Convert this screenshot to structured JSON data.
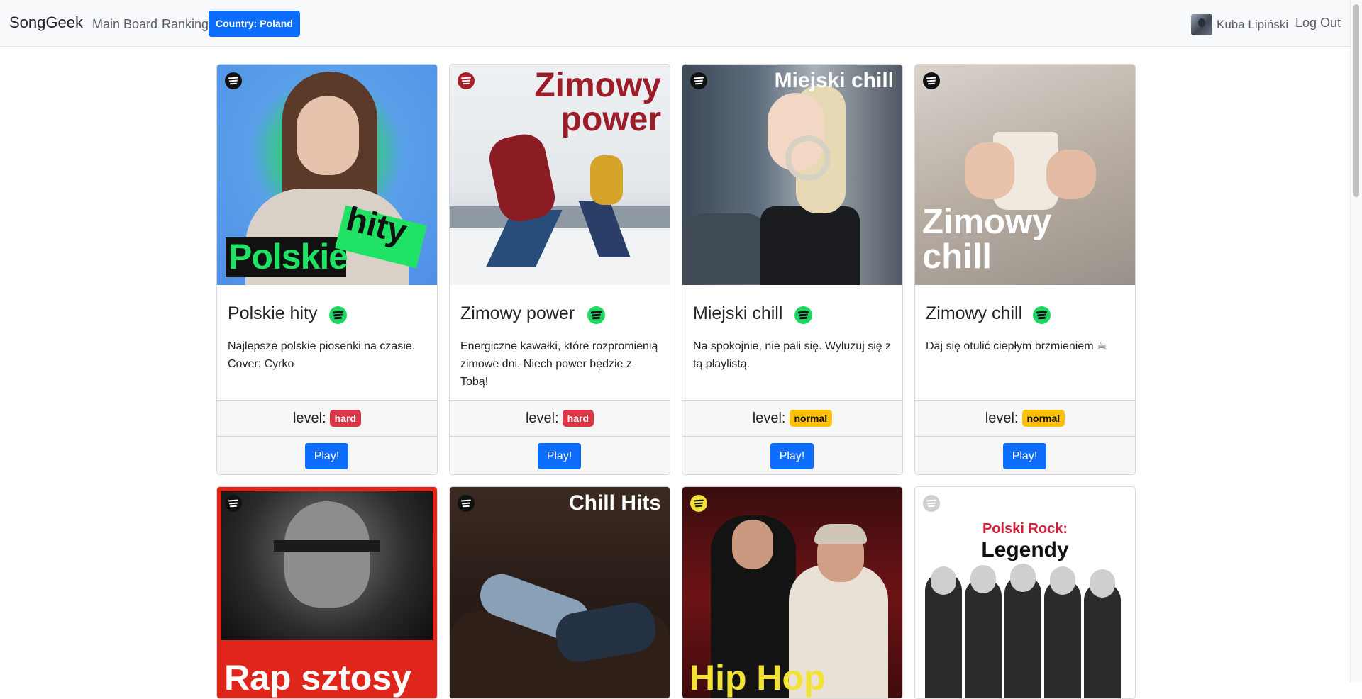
{
  "navbar": {
    "brand": "SongGeek",
    "links": [
      "Main Board",
      "Ranking"
    ],
    "country_button": "Country: Poland",
    "user_name": "Kuba Lipiński",
    "logout": "Log Out"
  },
  "level_label": "level:",
  "play_label": "Play!",
  "colors": {
    "primary": "#0d6efd",
    "hard": "#dc3545",
    "normal": "#ffc107",
    "spotify_green": "#1ed760"
  },
  "playlists": [
    {
      "cover_lines": [
        "Polskie",
        "hity"
      ],
      "title": "Polskie hity",
      "description": "Najlepsze polskie piosenki na czasie. Cover: Cyrko",
      "level": "hard"
    },
    {
      "cover_lines": [
        "Zimowy",
        "power"
      ],
      "title": "Zimowy power",
      "description": "Energiczne kawałki, które rozpromienią zimowe dni. Niech power będzie z Tobą!",
      "level": "hard"
    },
    {
      "cover_lines": [
        "Miejski chill"
      ],
      "title": "Miejski chill",
      "description": "Na spokojnie, nie pali się. Wyluzuj się z tą playlistą.",
      "level": "normal"
    },
    {
      "cover_lines": [
        "Zimowy",
        "chill"
      ],
      "title": "Zimowy chill",
      "description": "Daj się otulić ciepłym brzmieniem ☕",
      "level": "normal"
    },
    {
      "cover_lines": [
        "Rap sztosy"
      ]
    },
    {
      "cover_lines": [
        "Chill Hits"
      ]
    },
    {
      "cover_lines": [
        "Hip Hop Alert"
      ]
    },
    {
      "cover_lines": [
        "Polski Rock:",
        "Legendy"
      ]
    }
  ]
}
